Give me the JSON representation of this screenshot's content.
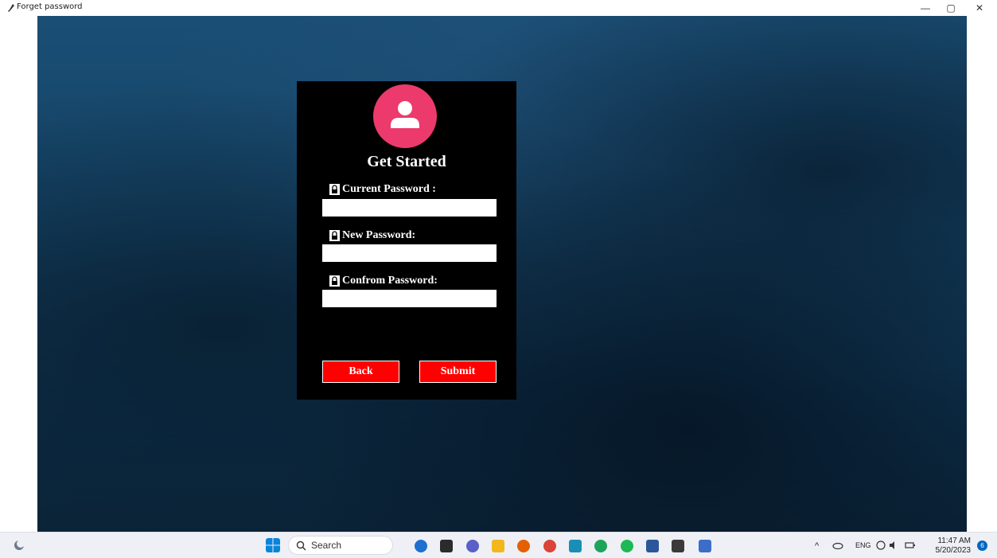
{
  "window": {
    "title": "Forget password",
    "minimize_glyph": "—",
    "maximize_glyph": "▢",
    "close_glyph": "✕"
  },
  "form": {
    "heading": "Get Started",
    "fields": [
      {
        "label": "Current Password :",
        "value": "",
        "icon": "lock-icon"
      },
      {
        "label": "New Password:",
        "value": "",
        "icon": "lock-icon"
      },
      {
        "label": "Confrom Password:",
        "value": "",
        "icon": "lock-icon"
      }
    ],
    "back_label": "Back",
    "submit_label": "Submit",
    "avatar_icon": "user-icon",
    "colors": {
      "card": "#000000",
      "avatar": "#ec3a6c",
      "buttons": "#ff0000"
    }
  },
  "taskbar": {
    "search_label": "Search",
    "language": "ENG",
    "time": "11:47 AM",
    "date": "5/20/2023",
    "notification_count": "6"
  }
}
